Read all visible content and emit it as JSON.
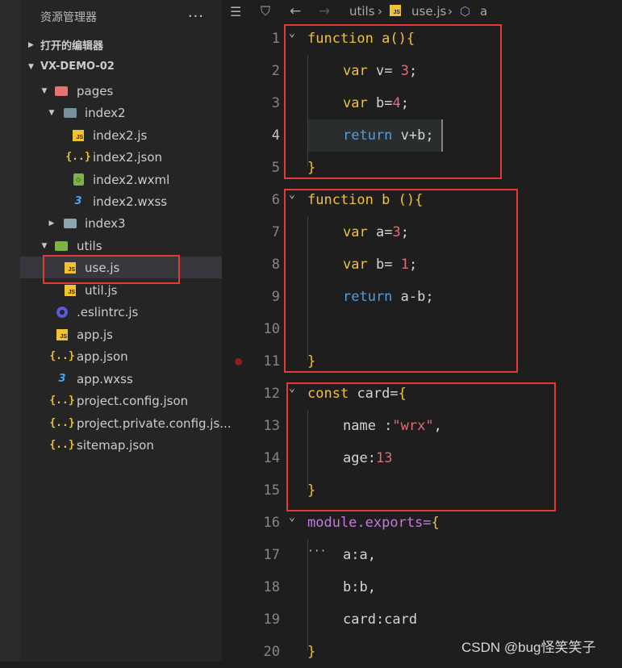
{
  "sidebar": {
    "title": "资源管理器",
    "more": "···",
    "open_editors": "打开的编辑器",
    "project": "VX-DEMO-02",
    "items": [
      {
        "label": "pages"
      },
      {
        "label": "index2"
      },
      {
        "label": "index2.js"
      },
      {
        "label": "index2.json"
      },
      {
        "label": "index2.wxml"
      },
      {
        "label": "index2.wxss"
      },
      {
        "label": "index3"
      },
      {
        "label": "utils"
      },
      {
        "label": "use.js"
      },
      {
        "label": "util.js"
      },
      {
        "label": ".eslintrc.js"
      },
      {
        "label": "app.js"
      },
      {
        "label": "app.json"
      },
      {
        "label": "app.wxss"
      },
      {
        "label": "project.config.json"
      },
      {
        "label": "project.private.config.js..."
      },
      {
        "label": "sitemap.json"
      }
    ]
  },
  "breadcrumb": {
    "folder": "utils",
    "file": "use.js",
    "symbol": "a"
  },
  "editor": {
    "current_line": "4",
    "line_numbers": [
      "1",
      "2",
      "3",
      "4",
      "5",
      "6",
      "7",
      "8",
      "9",
      "10",
      "11",
      "12",
      "13",
      "14",
      "15",
      "16",
      "17",
      "18",
      "19",
      "20"
    ]
  },
  "watermark": "CSDN @bug怪笑笑子",
  "colors": {
    "highlight_box": "#e53935",
    "keyword": "#569cd6",
    "function_keyword": "#f1c232",
    "number": "#e06c75",
    "module": "#c678dd"
  }
}
